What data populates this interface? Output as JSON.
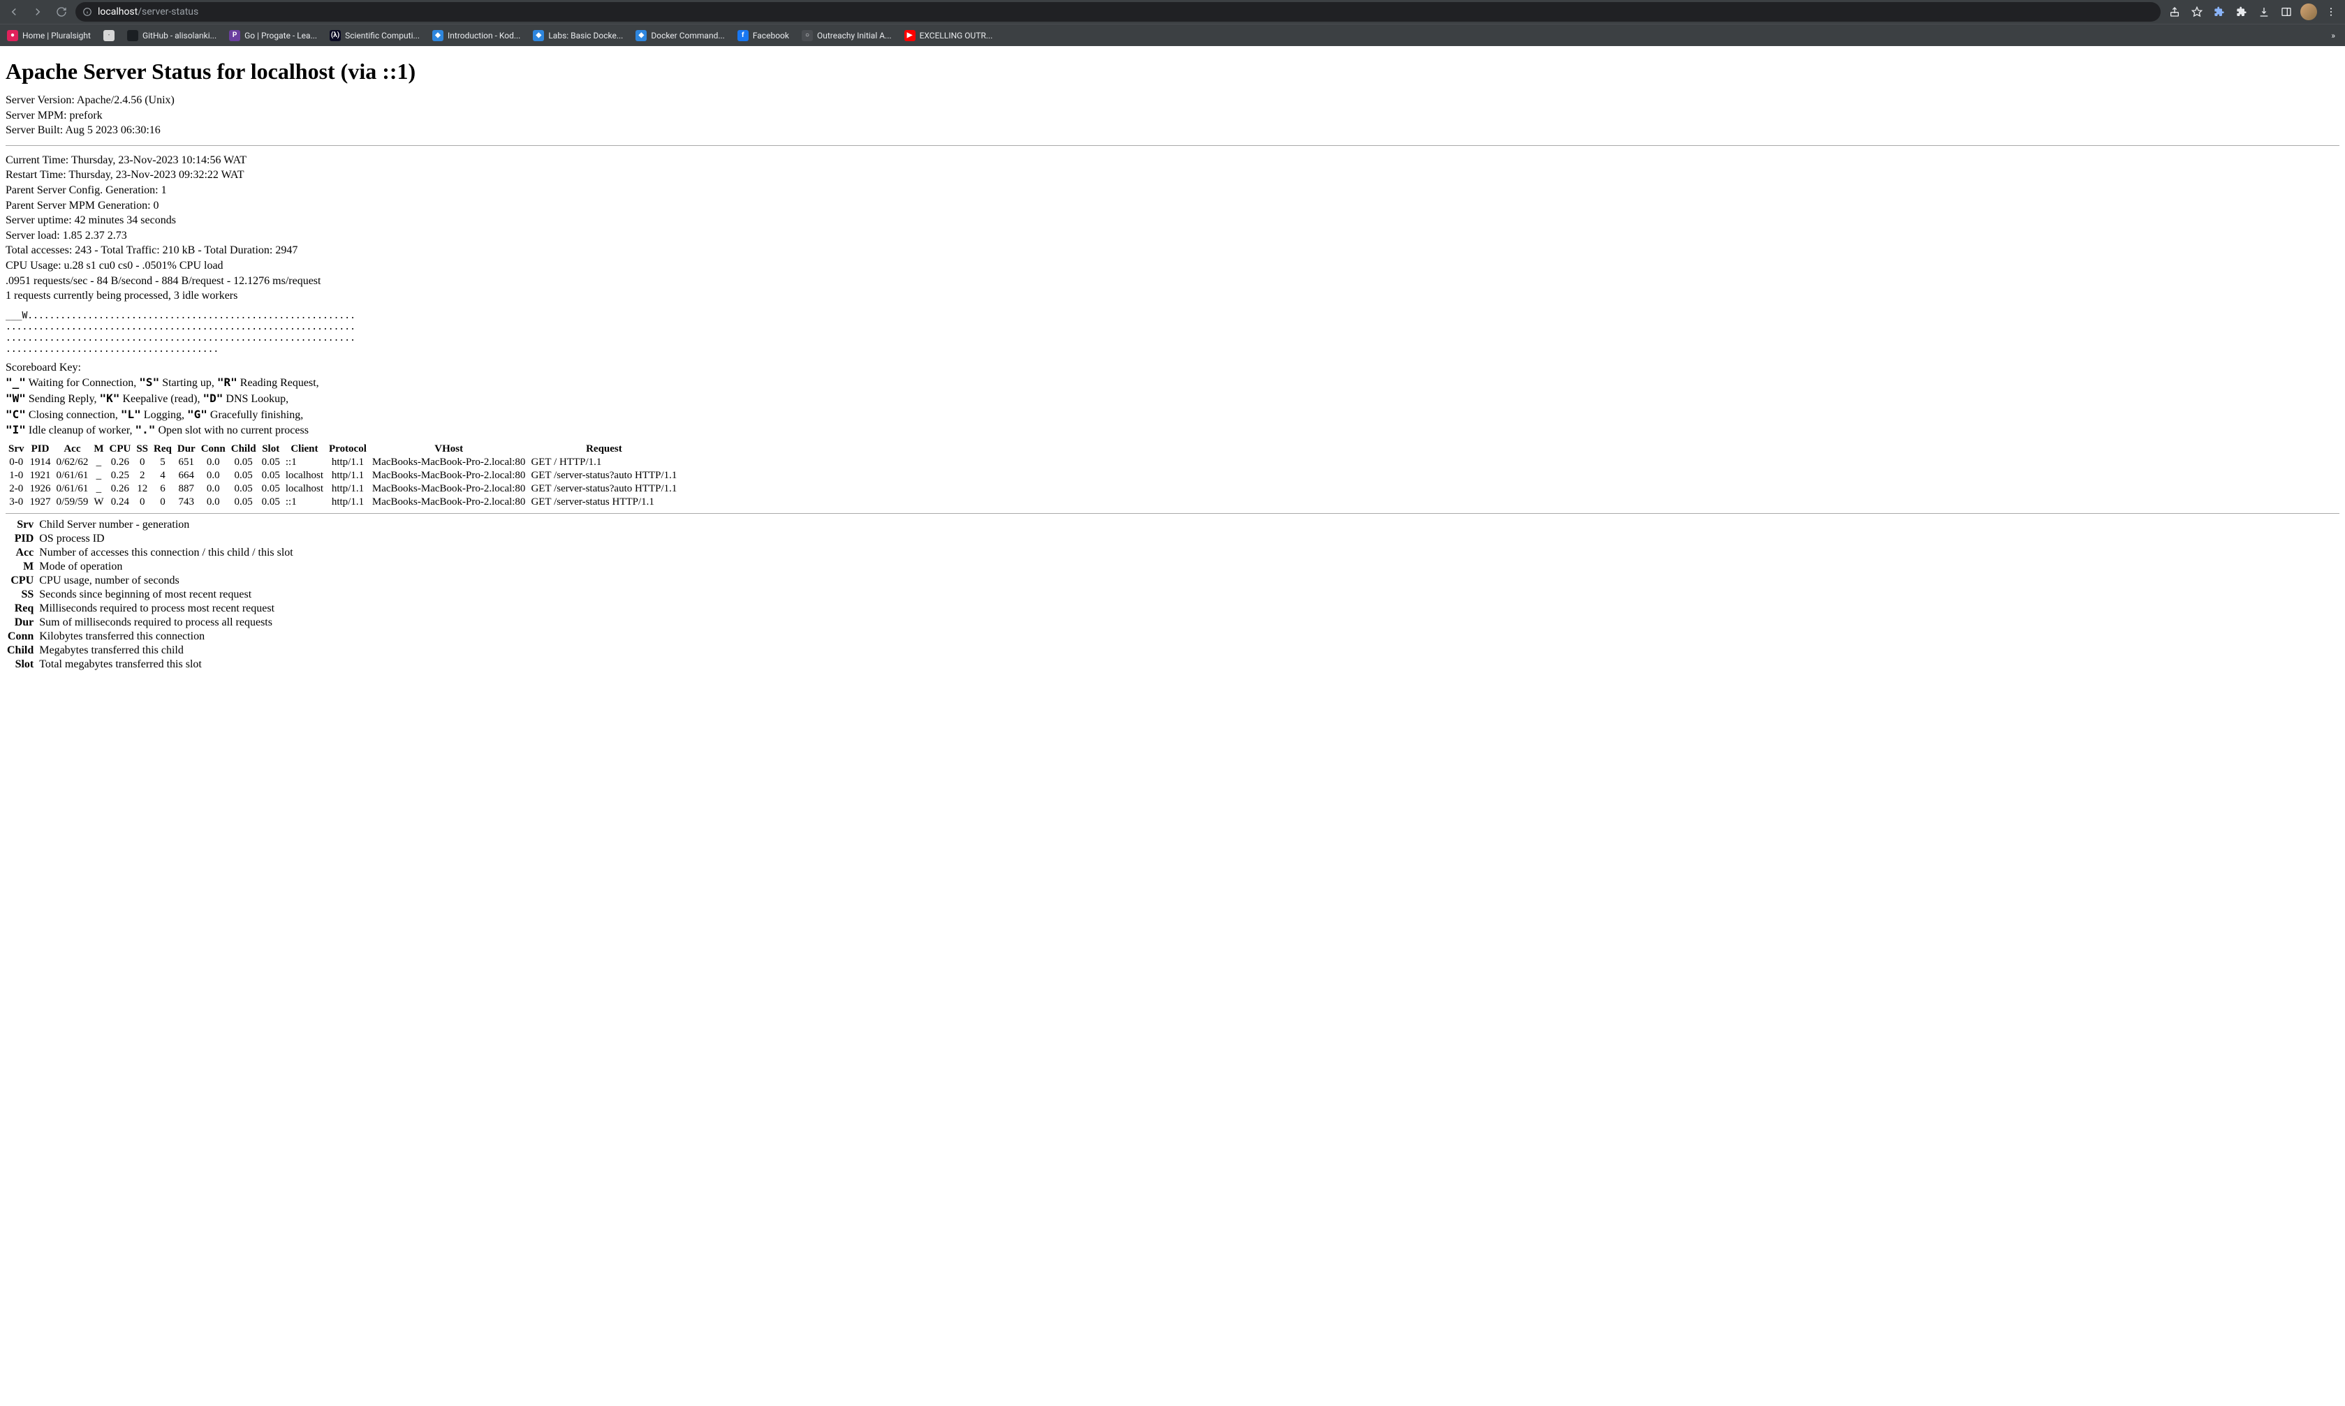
{
  "browser": {
    "url_host": "localhost",
    "url_path": "/server-status",
    "bookmarks": [
      {
        "label": "Home | Pluralsight",
        "bg": "#e1215b",
        "fg": "#fff",
        "glyph": "●"
      },
      {
        "label": "",
        "bg": "#d7d7d7",
        "fg": "#666",
        "glyph": "·"
      },
      {
        "label": "GitHub - alisolanki...",
        "bg": "#1b1f23",
        "fg": "#fff",
        "glyph": ""
      },
      {
        "label": "Go | Progate - Lea...",
        "bg": "#6b3fa0",
        "fg": "#fff",
        "glyph": "P"
      },
      {
        "label": "Scientific Computi...",
        "bg": "#0a0a23",
        "fg": "#fff",
        "glyph": "(λ)"
      },
      {
        "label": "Introduction - Kod...",
        "bg": "#2e86de",
        "fg": "#fff",
        "glyph": "◆"
      },
      {
        "label": "Labs: Basic Docke...",
        "bg": "#2e86de",
        "fg": "#fff",
        "glyph": "◆"
      },
      {
        "label": "Docker Command...",
        "bg": "#2e86de",
        "fg": "#fff",
        "glyph": "◆"
      },
      {
        "label": "Facebook",
        "bg": "#1877f2",
        "fg": "#fff",
        "glyph": "f"
      },
      {
        "label": "Outreachy Initial A...",
        "bg": "#4a4d51",
        "fg": "#e8eaed",
        "glyph": "○"
      },
      {
        "label": "EXCELLING OUTR...",
        "bg": "#ff0000",
        "fg": "#fff",
        "glyph": "▶"
      }
    ]
  },
  "page": {
    "title": "Apache Server Status for localhost (via ::1)",
    "server_info": [
      "Server Version: Apache/2.4.56 (Unix)",
      "Server MPM: prefork",
      "Server Built: Aug 5 2023 06:30:16"
    ],
    "stats": [
      "Current Time: Thursday, 23-Nov-2023 10:14:56 WAT",
      "Restart Time: Thursday, 23-Nov-2023 09:32:22 WAT",
      "Parent Server Config. Generation: 1",
      "Parent Server MPM Generation: 0",
      "Server uptime: 42 minutes 34 seconds",
      "Server load: 1.85 2.37 2.73",
      "Total accesses: 243 - Total Traffic: 210 kB - Total Duration: 2947",
      "CPU Usage: u.28 s1 cu0 cs0 - .0501% CPU load",
      ".0951 requests/sec - 84 B/second - 884 B/request - 12.1276 ms/request",
      "1 requests currently being processed, 3 idle workers"
    ],
    "scoreboard": "___W............................................................\n................................................................\n................................................................\n.......................................",
    "scoreboard_key_title": "Scoreboard Key:",
    "scoreboard_key": [
      [
        {
          "m": "\"_\""
        },
        {
          "t": " Waiting for Connection, "
        },
        {
          "m": "\"S\""
        },
        {
          "t": " Starting up, "
        },
        {
          "m": "\"R\""
        },
        {
          "t": " Reading Request,"
        }
      ],
      [
        {
          "m": "\"W\""
        },
        {
          "t": " Sending Reply, "
        },
        {
          "m": "\"K\""
        },
        {
          "t": " Keepalive (read), "
        },
        {
          "m": "\"D\""
        },
        {
          "t": " DNS Lookup,"
        }
      ],
      [
        {
          "m": "\"C\""
        },
        {
          "t": " Closing connection, "
        },
        {
          "m": "\"L\""
        },
        {
          "t": " Logging, "
        },
        {
          "m": "\"G\""
        },
        {
          "t": " Gracefully finishing,"
        }
      ],
      [
        {
          "m": "\"I\""
        },
        {
          "t": " Idle cleanup of worker, "
        },
        {
          "m": "\".\""
        },
        {
          "t": " Open slot with no current process"
        }
      ]
    ],
    "worker_headers": [
      "Srv",
      "PID",
      "Acc",
      "M",
      "CPU",
      "SS",
      "Req",
      "Dur",
      "Conn",
      "Child",
      "Slot",
      "Client",
      "Protocol",
      "VHost",
      "Request"
    ],
    "workers": [
      {
        "srv": "0-0",
        "pid": "1914",
        "acc": "0/62/62",
        "m": "_",
        "cpu": "0.26",
        "ss": "0",
        "req": "5",
        "dur": "651",
        "conn": "0.0",
        "child": "0.05",
        "slot": "0.05",
        "client": "::1",
        "protocol": "http/1.1",
        "vhost": "MacBooks-MacBook-Pro-2.local:80",
        "request": "GET / HTTP/1.1"
      },
      {
        "srv": "1-0",
        "pid": "1921",
        "acc": "0/61/61",
        "m": "_",
        "cpu": "0.25",
        "ss": "2",
        "req": "4",
        "dur": "664",
        "conn": "0.0",
        "child": "0.05",
        "slot": "0.05",
        "client": "localhost",
        "protocol": "http/1.1",
        "vhost": "MacBooks-MacBook-Pro-2.local:80",
        "request": "GET /server-status?auto HTTP/1.1"
      },
      {
        "srv": "2-0",
        "pid": "1926",
        "acc": "0/61/61",
        "m": "_",
        "cpu": "0.26",
        "ss": "12",
        "req": "6",
        "dur": "887",
        "conn": "0.0",
        "child": "0.05",
        "slot": "0.05",
        "client": "localhost",
        "protocol": "http/1.1",
        "vhost": "MacBooks-MacBook-Pro-2.local:80",
        "request": "GET /server-status?auto HTTP/1.1"
      },
      {
        "srv": "3-0",
        "pid": "1927",
        "acc": "0/59/59",
        "m": "W",
        "cpu": "0.24",
        "ss": "0",
        "req": "0",
        "dur": "743",
        "conn": "0.0",
        "child": "0.05",
        "slot": "0.05",
        "client": "::1",
        "protocol": "http/1.1",
        "vhost": "MacBooks-MacBook-Pro-2.local:80",
        "request": "GET /server-status HTTP/1.1"
      }
    ],
    "glossary": [
      {
        "k": "Srv",
        "v": "Child Server number - generation"
      },
      {
        "k": "PID",
        "v": "OS process ID"
      },
      {
        "k": "Acc",
        "v": "Number of accesses this connection / this child / this slot"
      },
      {
        "k": "M",
        "v": "Mode of operation"
      },
      {
        "k": "CPU",
        "v": "CPU usage, number of seconds"
      },
      {
        "k": "SS",
        "v": "Seconds since beginning of most recent request"
      },
      {
        "k": "Req",
        "v": "Milliseconds required to process most recent request"
      },
      {
        "k": "Dur",
        "v": "Sum of milliseconds required to process all requests"
      },
      {
        "k": "Conn",
        "v": "Kilobytes transferred this connection"
      },
      {
        "k": "Child",
        "v": "Megabytes transferred this child"
      },
      {
        "k": "Slot",
        "v": "Total megabytes transferred this slot"
      }
    ]
  }
}
